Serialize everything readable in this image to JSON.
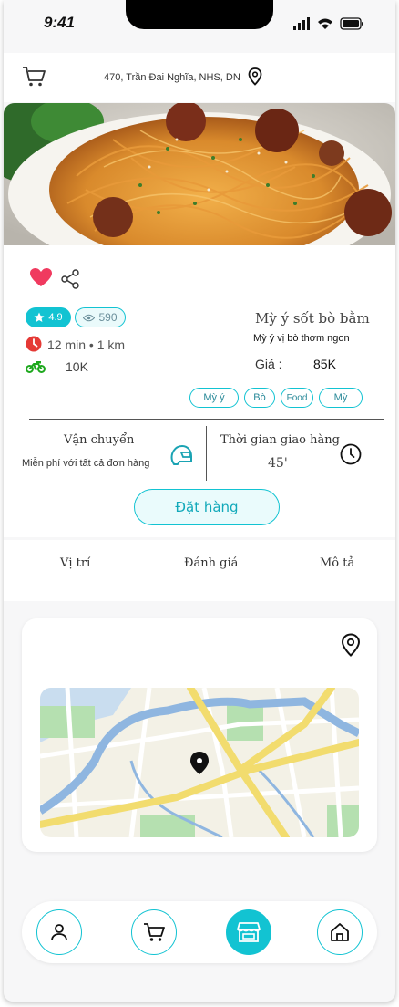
{
  "status": {
    "time": "9:41"
  },
  "header": {
    "address": "470, Trần Đại Nghĩa, NHS, DN"
  },
  "product": {
    "rating": "4.9",
    "views": "590",
    "eta": "12 min • 1 km",
    "shipping_fee": "10K",
    "name": "Mỳ ý sốt bò bằm",
    "description": "Mỳ ý vị bò thơm ngon",
    "price_label": "Giá :",
    "price": "85K",
    "tags": [
      "Mỳ ý",
      "Bò",
      "Food",
      "Mỳ"
    ]
  },
  "delivery": {
    "shipping_title": "Vận chuyển",
    "shipping_sub": "Miễn phí  với tất cả đơn hàng",
    "time_title": "Thời gian giao hàng",
    "time_value": "45'"
  },
  "actions": {
    "order_label": "Đặt hàng"
  },
  "tabs": [
    "Vị trí",
    "Đánh giá",
    "Mô tả"
  ],
  "nav": [
    "user-icon",
    "cart-icon",
    "store-icon",
    "home-icon"
  ],
  "colors": {
    "accent": "#12c3d2",
    "heart": "#f03a5f",
    "clock": "#e53935",
    "moto": "#1ea81e"
  }
}
